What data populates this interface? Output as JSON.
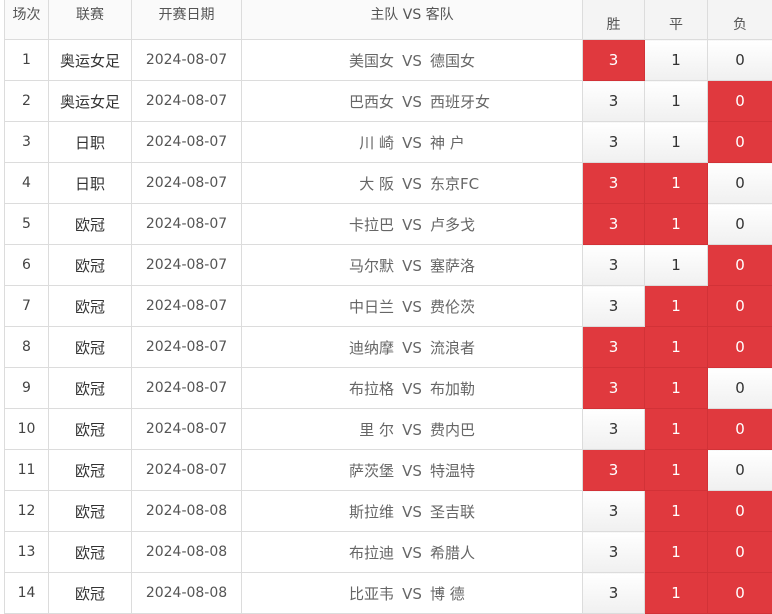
{
  "header": {
    "round": "场次",
    "league": "联赛",
    "date": "开赛日期",
    "match": "主队 VS 客队",
    "win": "胜",
    "draw": "平",
    "lose": "负"
  },
  "vs_label": "VS",
  "colors": {
    "selected": "#e0393e",
    "border": "#dcdcdc"
  },
  "rows": [
    {
      "n": "1",
      "league": "奥运女足",
      "date": "2024-08-07",
      "home": "美国女",
      "away": "德国女",
      "win": "3",
      "draw": "1",
      "lose": "0",
      "sel": [
        "win"
      ]
    },
    {
      "n": "2",
      "league": "奥运女足",
      "date": "2024-08-07",
      "home": "巴西女",
      "away": "西班牙女",
      "win": "3",
      "draw": "1",
      "lose": "0",
      "sel": [
        "lose"
      ]
    },
    {
      "n": "3",
      "league": "日职",
      "date": "2024-08-07",
      "home": "川 崎",
      "away": "神 户",
      "win": "3",
      "draw": "1",
      "lose": "0",
      "sel": [
        "lose"
      ]
    },
    {
      "n": "4",
      "league": "日职",
      "date": "2024-08-07",
      "home": "大 阪",
      "away": "东京FC",
      "win": "3",
      "draw": "1",
      "lose": "0",
      "sel": [
        "win",
        "draw"
      ]
    },
    {
      "n": "5",
      "league": "欧冠",
      "date": "2024-08-07",
      "home": "卡拉巴",
      "away": "卢多戈",
      "win": "3",
      "draw": "1",
      "lose": "0",
      "sel": [
        "win",
        "draw"
      ]
    },
    {
      "n": "6",
      "league": "欧冠",
      "date": "2024-08-07",
      "home": "马尔默",
      "away": "塞萨洛",
      "win": "3",
      "draw": "1",
      "lose": "0",
      "sel": [
        "lose"
      ]
    },
    {
      "n": "7",
      "league": "欧冠",
      "date": "2024-08-07",
      "home": "中日兰",
      "away": "费伦茨",
      "win": "3",
      "draw": "1",
      "lose": "0",
      "sel": [
        "draw",
        "lose"
      ]
    },
    {
      "n": "8",
      "league": "欧冠",
      "date": "2024-08-07",
      "home": "迪纳摩",
      "away": "流浪者",
      "win": "3",
      "draw": "1",
      "lose": "0",
      "sel": [
        "win",
        "draw",
        "lose"
      ]
    },
    {
      "n": "9",
      "league": "欧冠",
      "date": "2024-08-07",
      "home": "布拉格",
      "away": "布加勒",
      "win": "3",
      "draw": "1",
      "lose": "0",
      "sel": [
        "win",
        "draw"
      ]
    },
    {
      "n": "10",
      "league": "欧冠",
      "date": "2024-08-07",
      "home": "里 尔",
      "away": "费内巴",
      "win": "3",
      "draw": "1",
      "lose": "0",
      "sel": [
        "draw",
        "lose"
      ]
    },
    {
      "n": "11",
      "league": "欧冠",
      "date": "2024-08-07",
      "home": "萨茨堡",
      "away": "特温特",
      "win": "3",
      "draw": "1",
      "lose": "0",
      "sel": [
        "win",
        "draw"
      ]
    },
    {
      "n": "12",
      "league": "欧冠",
      "date": "2024-08-08",
      "home": "斯拉维",
      "away": "圣吉联",
      "win": "3",
      "draw": "1",
      "lose": "0",
      "sel": [
        "draw",
        "lose"
      ]
    },
    {
      "n": "13",
      "league": "欧冠",
      "date": "2024-08-08",
      "home": "布拉迪",
      "away": "希腊人",
      "win": "3",
      "draw": "1",
      "lose": "0",
      "sel": [
        "draw",
        "lose"
      ]
    },
    {
      "n": "14",
      "league": "欧冠",
      "date": "2024-08-08",
      "home": "比亚韦",
      "away": "博 德",
      "win": "3",
      "draw": "1",
      "lose": "0",
      "sel": [
        "draw",
        "lose"
      ]
    }
  ]
}
